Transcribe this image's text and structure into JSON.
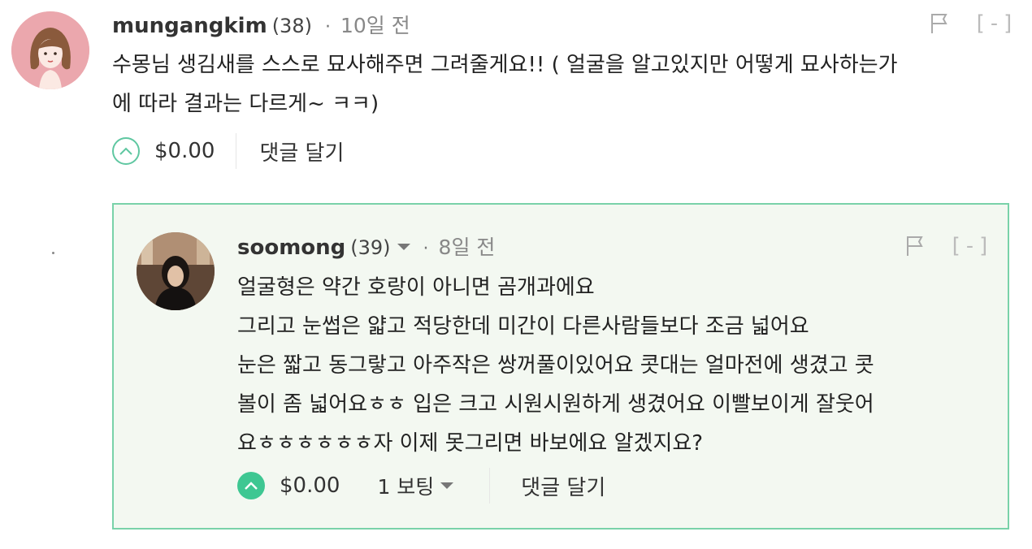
{
  "comments": [
    {
      "author": "mungangkim",
      "reputation": "(38)",
      "separator": "·",
      "time": "10일 전",
      "body_lines": [
        "수몽님 생김새를 스스로 묘사해주면 그려줄게요!! ( 얼굴을 알고있지만 어떻게 묘사하는가",
        "에 따라 결과는 다르게~ ㅋㅋ)"
      ],
      "payout": "$0.00",
      "reply_label": "댓글 달기",
      "collapse_label": "[-]",
      "avatar_icon": "cartoon-girl-avatar-icon",
      "upvote_icon": "upvote-chevron-icon",
      "flag_icon": "flag-icon"
    },
    {
      "author": "soomong",
      "reputation": "(39)",
      "separator": "·",
      "time": "8일 전",
      "body_lines": [
        "얼굴형은 약간 호랑이 아니면 곰개과에요",
        "그리고 눈썹은 얇고 적당한데 미간이 다른사람들보다 조금 넓어요",
        "눈은 짧고 동그랗고 아주작은 쌍꺼풀이있어요 콧대는 얼마전에 생겼고 콧",
        "볼이 좀 넓어요ㅎㅎ 입은 크고 시원시원하게 생겼어요 이빨보이게 잘웃어",
        "요ㅎㅎㅎㅎㅎㅎ자 이제 못그리면 바보에요 알겠지요?"
      ],
      "payout": "$0.00",
      "votes_label": "1 보팅",
      "reply_label": "댓글 달기",
      "collapse_label": "[-]",
      "avatar_icon": "photo-avatar-icon",
      "upvote_icon": "upvote-chevron-icon",
      "flag_icon": "flag-icon"
    }
  ],
  "colors": {
    "accent_green": "#3ec792",
    "nested_background": "#f3f8f1",
    "nested_border": "#79d2a9",
    "avatar_pink": "#eba7ad"
  }
}
